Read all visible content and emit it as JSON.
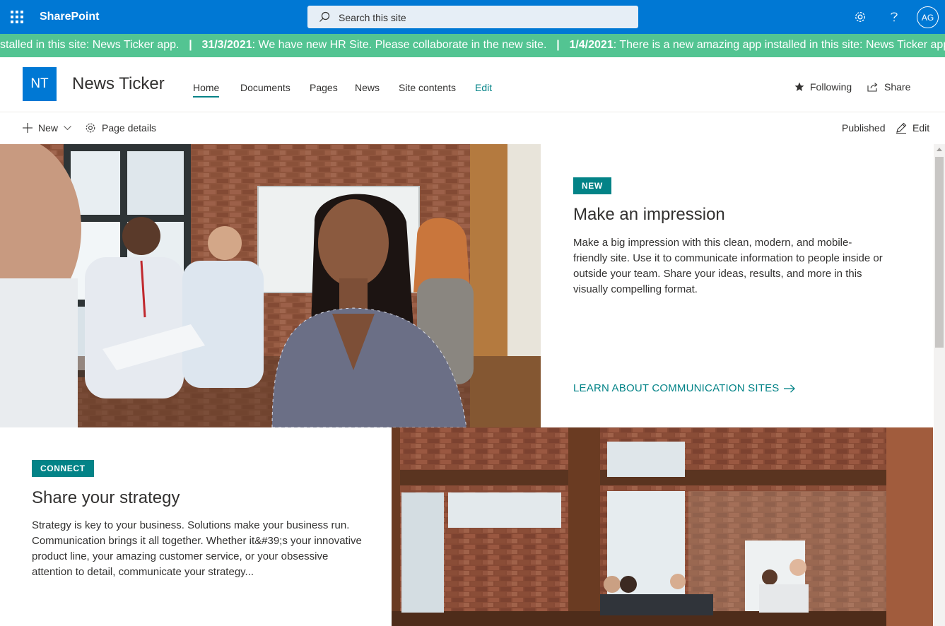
{
  "suite_bar": {
    "app_name": "SharePoint",
    "search_placeholder": "Search this site",
    "user_initials": "AG"
  },
  "ticker": {
    "items": [
      {
        "date": "",
        "text": "stalled in this site: News Ticker app."
      },
      {
        "date": "31/3/2021",
        "text": ": We have new HR Site. Please collaborate in the new site."
      },
      {
        "date": "1/4/2021",
        "text": ": There is a new amazing app installed in this site: News Ticker app."
      }
    ],
    "separator": "|"
  },
  "site_header": {
    "logo_initials": "NT",
    "title": "News Ticker",
    "nav": [
      {
        "label": "Home",
        "active": true
      },
      {
        "label": "Documents"
      },
      {
        "label": "Pages"
      },
      {
        "label": "News"
      },
      {
        "label": "Site contents"
      },
      {
        "label": "Edit"
      }
    ],
    "following_label": "Following",
    "share_label": "Share"
  },
  "command_bar": {
    "new_label": "New",
    "page_details_label": "Page details",
    "status_label": "Published",
    "edit_label": "Edit"
  },
  "hero1": {
    "badge": "NEW",
    "title": "Make an impression",
    "description": "Make a big impression with this clean, modern, and mobile-friendly site. Use it to communicate information to people inside or outside your team. Share your ideas, results, and more in this visually compelling format.",
    "link_label": "LEARN ABOUT COMMUNICATION SITES"
  },
  "section2": {
    "badge": "CONNECT",
    "title": "Share your strategy",
    "description": "Strategy is key to your business. Solutions make your business run. Communication brings it all together. Whether it&#39;s your innovative product line, your amazing customer service, or your obsessive attention to detail, communicate your strategy..."
  },
  "colors": {
    "suite_bar": "#0078d4",
    "ticker": "#53c492",
    "theme": "#038387"
  }
}
